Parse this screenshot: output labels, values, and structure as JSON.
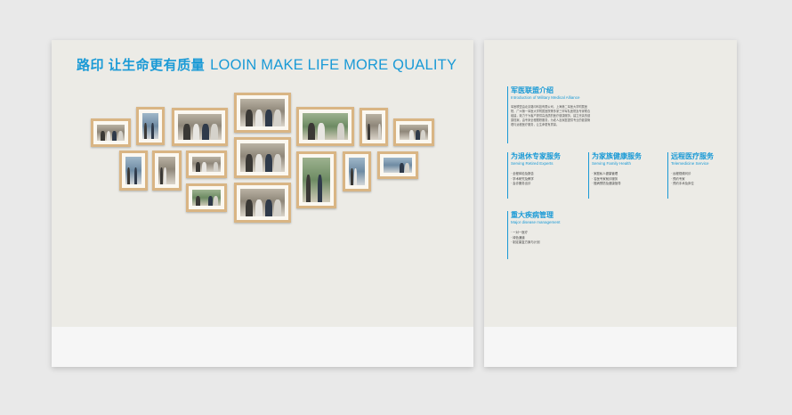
{
  "left_panel": {
    "headline_cn": "路印 让生命更有质量",
    "headline_en": "LOOIN MAKE LIFE MORE QUALITY",
    "photo_count": 17
  },
  "right_panel": {
    "sections": [
      {
        "title": "军医联盟介绍",
        "subtitle": "Introduction of Military Medical Alliance",
        "paragraph": "军医联盟由北京路印科技有限公司、上海第二军医大学附属医院、广州第一军医大学附属医院等多家三甲军队医院及专家联合组建，致力于为客户提供高品质的医疗健康服务，建立完善的健康档案，由专家全程跟踪服务，为老人及家庭提供专业的健康管理与远程医疗服务，让生命更有质量。"
      },
      {
        "title": "为退休专家服务",
        "subtitle": "Serving Retired Experts",
        "items": [
          "· 全程体检及报告",
          "· 学术研究及教学",
          "· 会诊服务出诊"
        ]
      },
      {
        "title": "为家族健康服务",
        "subtitle": "Serving Family Health",
        "items": [
          "· 家庭私人健康管理",
          "· 名医专家就诊服务",
          "· 慢病预防及健康指导"
        ]
      },
      {
        "title": "远程医疗服务",
        "subtitle": "Telemedicine Service",
        "items": [
          "· 远程视频问诊",
          "· 预约专家",
          "· 预约手术及床位"
        ]
      },
      {
        "title": "重大疾病管理",
        "subtitle": "Major disease management",
        "items": [
          "· 一对一医疗",
          "· 绿色通道",
          "· 制定康复方案与计划"
        ]
      }
    ]
  }
}
